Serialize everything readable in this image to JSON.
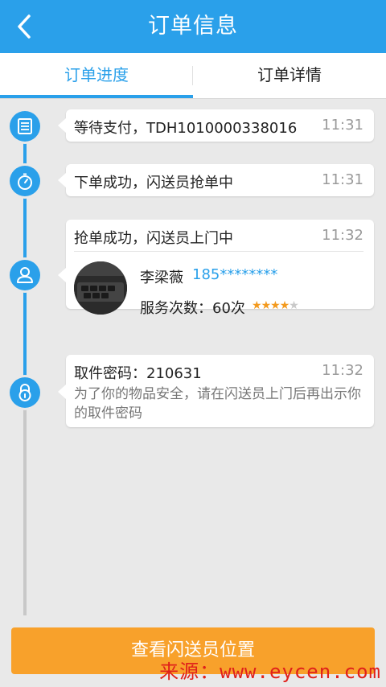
{
  "header": {
    "title": "订单信息"
  },
  "tabs": [
    {
      "label": "订单进度",
      "active": true
    },
    {
      "label": "订单详情",
      "active": false
    }
  ],
  "timeline": [
    {
      "text": "等待支付，TDH1010000338016",
      "time": "11:31",
      "icon": "document-icon"
    },
    {
      "text": "下单成功，闪送员抢单中",
      "time": "11:31",
      "icon": "stopwatch-icon"
    },
    {
      "text": "抢单成功，闪送员上门中",
      "time": "11:32",
      "icon": "user-icon",
      "courier": {
        "name": "李梁薇",
        "phone": "185********",
        "service_label": "服务次数：",
        "service_count": "60次",
        "rating": 4,
        "rating_max": 5
      }
    },
    {
      "text": "取件密码：210631",
      "time": "11:32",
      "icon": "lock-icon",
      "desc": "为了你的物品安全，请在闪送员上门后再出示你的取件密码"
    }
  ],
  "action_button": {
    "label": "查看闪送员位置"
  },
  "watermark": "来源：www.eycen.com",
  "colors": {
    "primary": "#2aa0ea",
    "accent": "#f8a12b",
    "star": "#f39a1e"
  }
}
